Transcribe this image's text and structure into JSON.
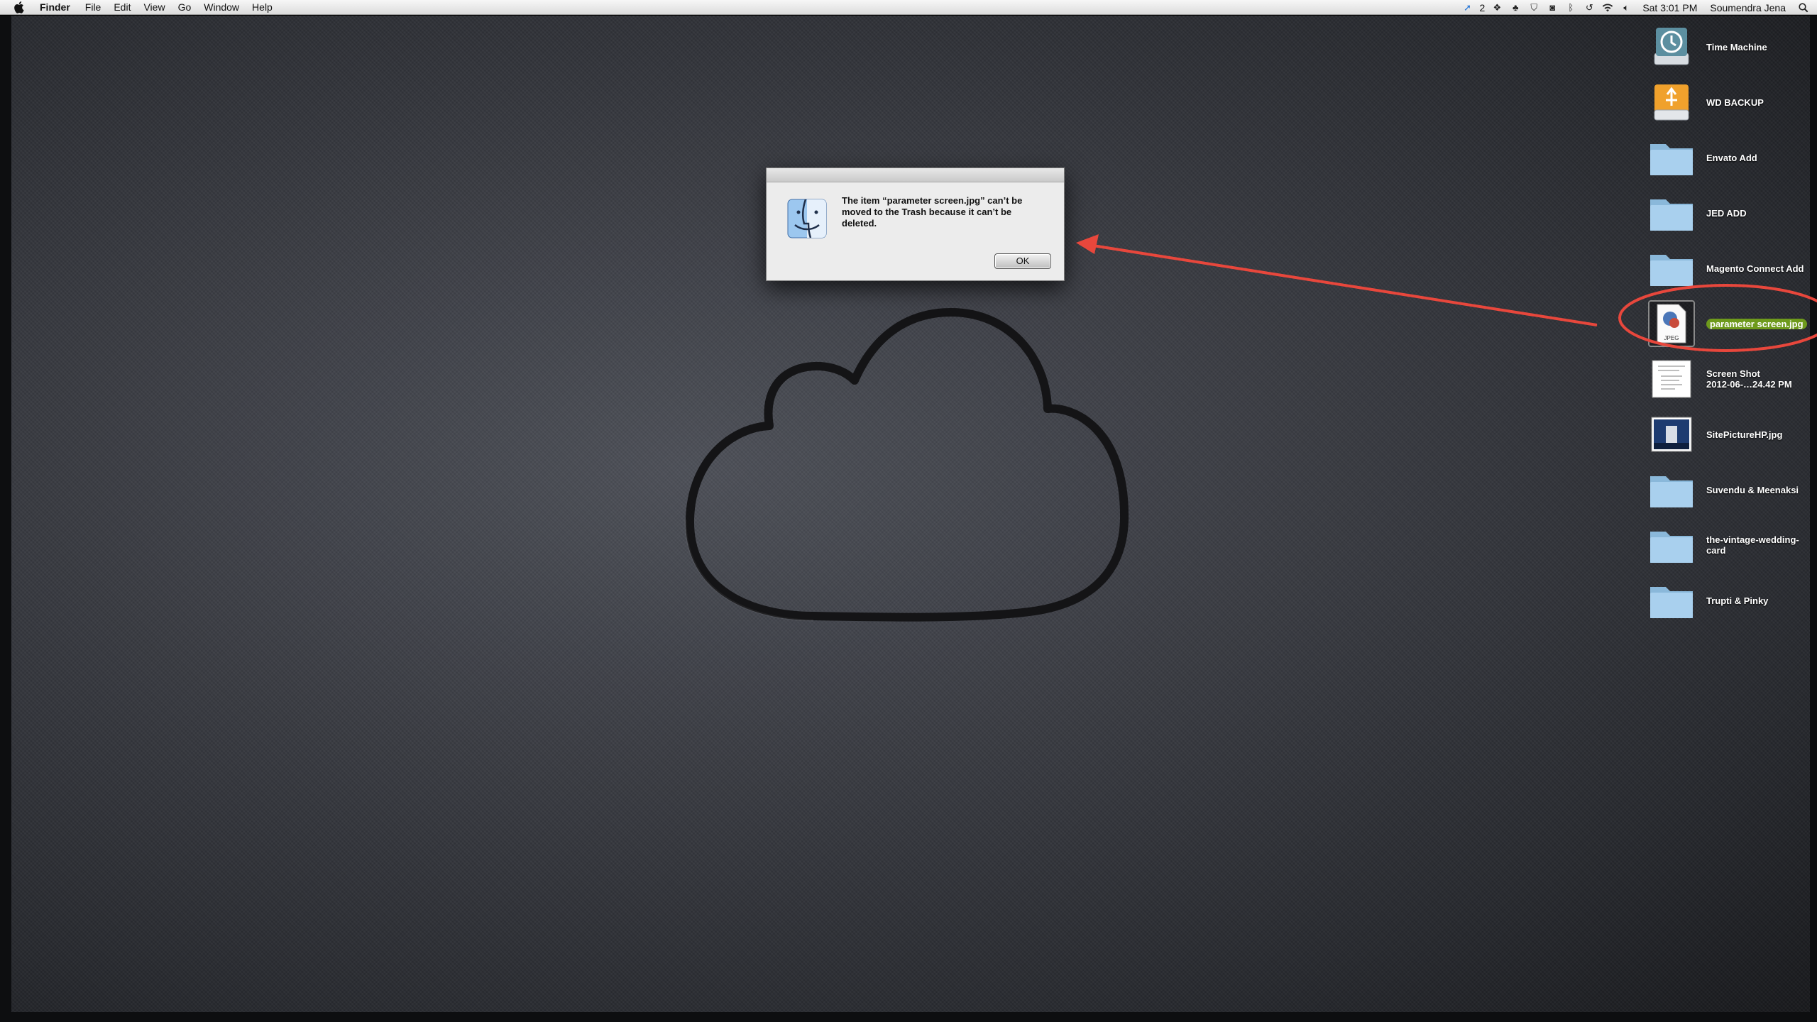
{
  "menubar": {
    "app_name": "Finder",
    "menus": [
      "File",
      "Edit",
      "View",
      "Go",
      "Window",
      "Help"
    ],
    "status": {
      "notification_count": "2",
      "clock": "Sat 3:01 PM",
      "user": "Soumendra Jena"
    }
  },
  "dialog": {
    "message": "The item “parameter screen.jpg” can’t be moved to the Trash because it can’t be deleted.",
    "ok_label": "OK"
  },
  "desktop_icons": [
    {
      "label": "Time Machine",
      "icon": "time-machine-drive-icon"
    },
    {
      "label": "WD BACKUP",
      "icon": "usb-drive-icon"
    },
    {
      "label": "Envato Add",
      "icon": "folder-icon"
    },
    {
      "label": "JED ADD",
      "icon": "folder-icon"
    },
    {
      "label": "Magento Connect Add",
      "icon": "folder-icon"
    },
    {
      "label": "parameter screen.jpg",
      "icon": "jpeg-file-icon",
      "selected": true
    },
    {
      "label": "Screen Shot\n2012-06-…24.42 PM",
      "icon": "screenshot-file-icon"
    },
    {
      "label": "SitePictureHP.jpg",
      "icon": "image-file-icon"
    },
    {
      "label": "Suvendu & Meenaksi",
      "icon": "folder-icon"
    },
    {
      "label": "the-vintage-wedding-\ncard",
      "icon": "folder-icon"
    },
    {
      "label": "Trupti & Pinky",
      "icon": "folder-icon"
    }
  ],
  "colors": {
    "annotation": "#e8473c",
    "selection_label": "#6e9a1c"
  }
}
